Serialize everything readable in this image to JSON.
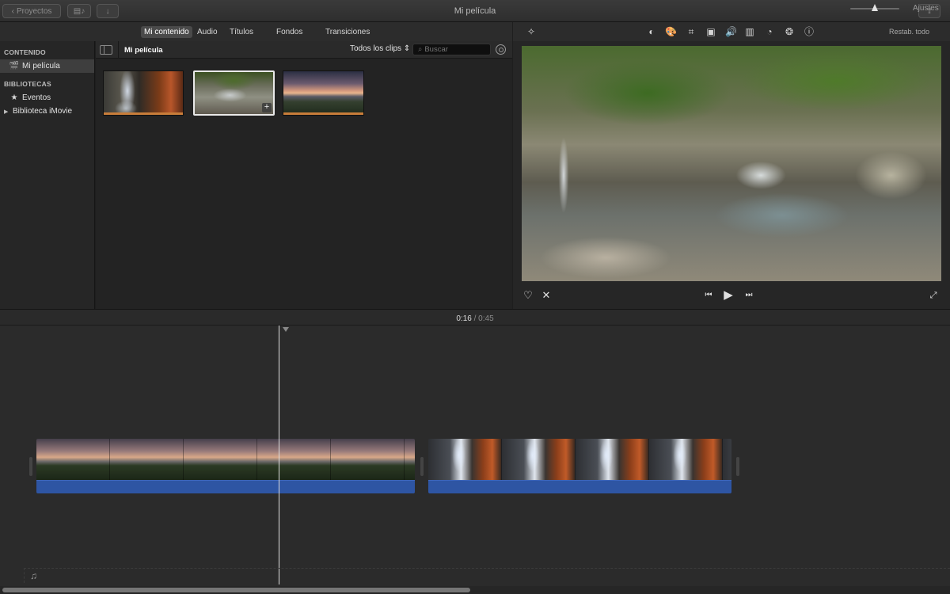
{
  "window": {
    "title": "Mi película",
    "projects_label": "Proyectos"
  },
  "browser": {
    "tabs": [
      {
        "label": "Mi contenido",
        "active": true
      },
      {
        "label": "Audio",
        "active": false
      },
      {
        "label": "Títulos",
        "active": false
      },
      {
        "label": "Fondos",
        "active": false
      },
      {
        "label": "Transiciones",
        "active": false
      }
    ],
    "content_title": "Mi película",
    "filter": "Todos los clips",
    "search_placeholder": "Buscar"
  },
  "sidebar": {
    "sections": [
      {
        "header": "CONTENIDO",
        "items": [
          {
            "label": "Mi película",
            "icon": "clapperboard-icon",
            "selected": true
          }
        ]
      },
      {
        "header": "BIBLIOTECAS",
        "items": [
          {
            "label": "Eventos",
            "icon": "star-icon",
            "selected": false
          },
          {
            "label": "Biblioteca iMovie",
            "icon": "disclosure-triangle-icon",
            "selected": false
          }
        ]
      }
    ]
  },
  "clips": [
    {
      "name": "waterfall-clip",
      "selected": false
    },
    {
      "name": "stream-clip",
      "selected": true
    },
    {
      "name": "sunset-clip",
      "selected": false
    }
  ],
  "viewer": {
    "reset_all": "Restab. todo",
    "tools": [
      "magic-wand-icon",
      "color-balance-icon",
      "color-palette-icon",
      "crop-icon",
      "stabilization-icon",
      "volume-icon",
      "equalizer-icon",
      "speed-icon",
      "filter-icon",
      "info-icon"
    ]
  },
  "timeline": {
    "current_time": "0:16",
    "separator": "/",
    "total_time": "0:45",
    "settings_label": "Ajustes",
    "zoom_level": 0.5
  },
  "colors": {
    "accent_audio": "#2e55a3",
    "clip_used_bar": "#c87d3a"
  }
}
